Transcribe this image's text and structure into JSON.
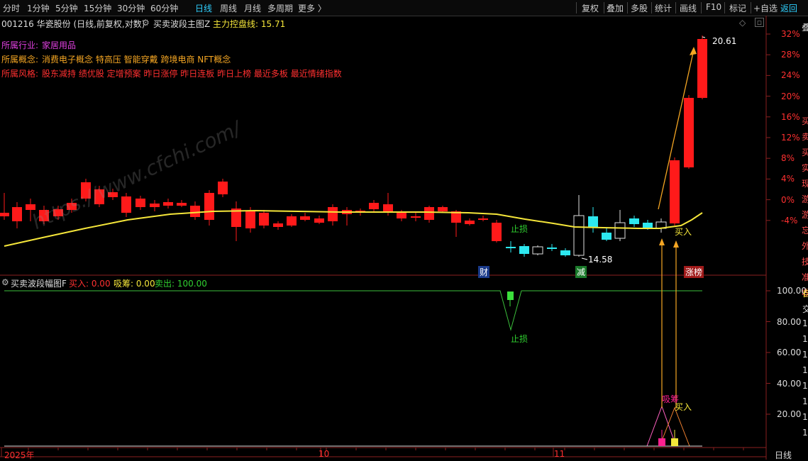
{
  "toolbar": {
    "periods": [
      "分时",
      "1分钟",
      "5分钟",
      "15分钟",
      "30分钟",
      "60分钟",
      "日线",
      "周线",
      "月线",
      "多周期",
      "更多 〉"
    ],
    "active_period": "日线",
    "right_buttons": [
      "复权",
      "叠加",
      "多股",
      "统计",
      "画线",
      "F10",
      "标记",
      "+自选",
      "返回"
    ]
  },
  "stock_header": {
    "code_name": "001216 华瓷股份 (日线,前复权,对数)",
    "indicator": "买卖波段主图Z",
    "control_line": "主力控盘线: 15.71"
  },
  "info": {
    "industry_label": "所属行业:",
    "industry": "家居用品",
    "concept_label": "所属概念:",
    "concepts": "消费电子概念 特高压 智能穿戴 跨境电商 NFT概念",
    "style_label": "所属风格:",
    "styles": "股东减持 绩优股 定增预案 昨日涨停 昨日连板 昨日上榜 最近多板 最近情绪指数"
  },
  "watermark": "https://www.cfchi.com/",
  "main_chart": {
    "y_ticks": [
      "32%",
      "28%",
      "24%",
      "20%",
      "16%",
      "12%",
      "8%",
      "4%",
      "0%",
      "-4%"
    ],
    "high_label": "20.61",
    "low_label": "14.58",
    "stop_label": "止损",
    "buy_label": "买入",
    "event_markers": [
      "财",
      "减",
      "涨榜"
    ],
    "right_edge_chars": [
      "叠",
      "买",
      "卖",
      "买",
      "实",
      "现",
      "游",
      "游",
      "忘",
      "外",
      "技",
      "准",
      "收"
    ]
  },
  "sub_chart": {
    "title": "买卖波段幅图F",
    "buy": "买入: 0.00",
    "absorb": "吸筹: 0.00",
    "sell": "卖出: 100.00",
    "y_ticks": [
      "100.00",
      "80.00",
      "60.00",
      "40.00",
      "20.00"
    ],
    "stop_label": "止损",
    "absorb_label": "吸筹",
    "buy_label": "买入",
    "right_edge_chars": [
      "自",
      "交",
      "1",
      "1",
      "1",
      "1",
      "1",
      "1",
      "1",
      "1"
    ]
  },
  "time_axis": {
    "labels": [
      "2025年",
      "10",
      "11"
    ],
    "period_label": "日线"
  },
  "colors": {
    "up": "#ff1a1a",
    "down": "#2de8f0",
    "ma": "#f5e63a",
    "axis": "#8a1f1f",
    "orange": "#f5a623"
  }
}
